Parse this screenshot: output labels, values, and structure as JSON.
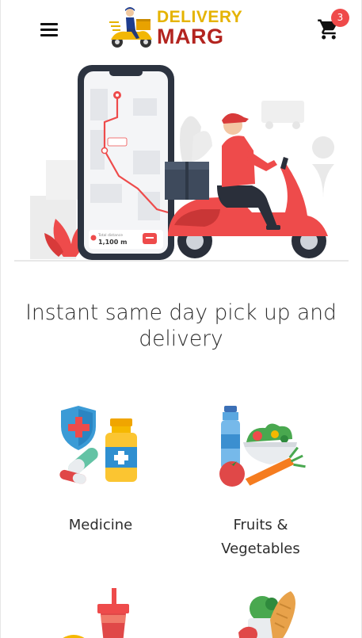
{
  "header": {
    "brand_line1": "DELIVERY",
    "brand_line2": "MARG",
    "cart_count": "3"
  },
  "hero": {
    "map_label_small": "Total distance",
    "map_distance": "1,100 m"
  },
  "headline": {
    "line1": "Instant same day pick up and",
    "line2": "delivery"
  },
  "categories": [
    {
      "label": "Medicine"
    },
    {
      "label_line1": "Fruits &",
      "label_line2": "Vegetables"
    }
  ],
  "colors": {
    "accent_red": "#ef4a4a",
    "brand_yellow": "#e5b300",
    "brand_red": "#b3241f"
  }
}
